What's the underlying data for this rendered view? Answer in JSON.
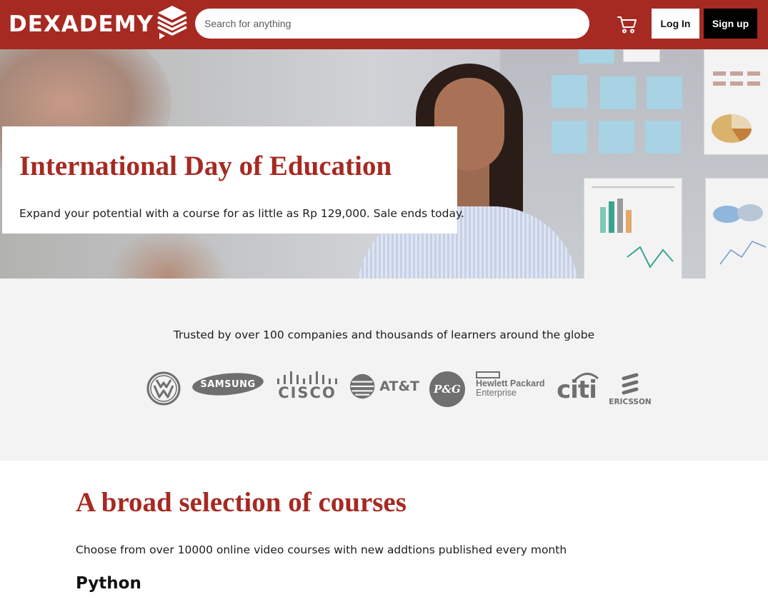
{
  "header": {
    "brand": "DEXADEMY",
    "search_placeholder": "Search for anything",
    "login_label": "Log In",
    "signup_label": "Sign up",
    "cart_icon": "cart-icon"
  },
  "hero": {
    "title": "International Day of Education",
    "subtitle": "Expand your potential with a course for as little as Rp 129,000. Sale ends today."
  },
  "trusted": {
    "text": "Trusted by over 100 companies and thousands of learners around the globe",
    "logos": {
      "samsung": "SAMSUNG",
      "cisco": "CISCO",
      "att": "AT&T",
      "pg": "P&G",
      "hpe_line1": "Hewlett Packard",
      "hpe_line2": "Enterprise",
      "citi": "citi",
      "ericsson": "ERICSSON"
    }
  },
  "courses": {
    "title": "A broad selection of courses",
    "description": "Choose from over 10000 online video courses with new addtions published every month",
    "topic": "Python"
  },
  "colors": {
    "brand": "#a62a22",
    "logo_gray": "#6f6f6f",
    "section_bg": "#f3f3f3"
  }
}
